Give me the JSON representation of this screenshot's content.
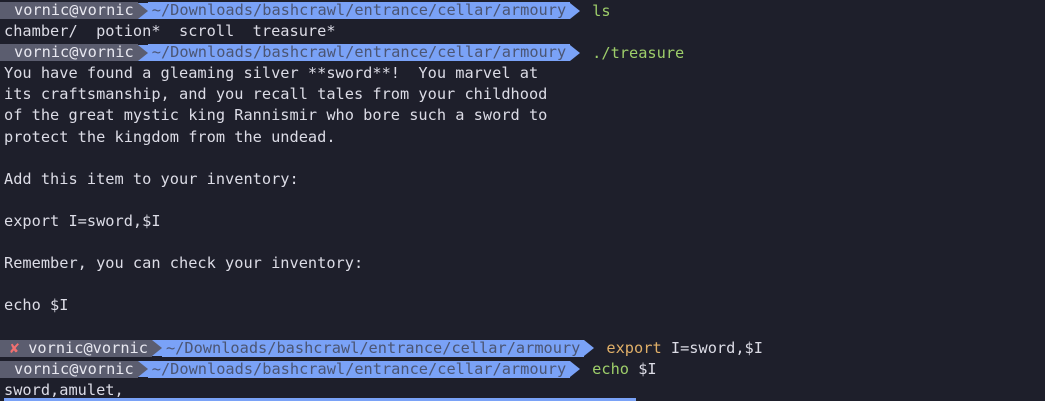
{
  "prompts": [
    {
      "user": "vornic@vornic",
      "path": "~/Downloads/bashcrawl/entrance/cellar/armoury",
      "cmd": "ls",
      "cmd_arg": ""
    },
    {
      "user": "vornic@vornic",
      "path": "~/Downloads/bashcrawl/entrance/cellar/armoury",
      "cmd": "./treasure",
      "cmd_arg": ""
    },
    {
      "error_mark": "✘",
      "user": "vornic@vornic",
      "path": "~/Downloads/bashcrawl/entrance/cellar/armoury",
      "cmd": "export",
      "cmd_arg": " I=sword,$I"
    },
    {
      "user": "vornic@vornic",
      "path": "~/Downloads/bashcrawl/entrance/cellar/armoury",
      "cmd": "echo",
      "cmd_arg": " $I"
    }
  ],
  "output": {
    "ls": "chamber/  potion*  scroll  treasure*",
    "treasure": [
      "You have found a gleaming silver **sword**!  You marvel at",
      "its craftsmanship, and you recall tales from your childhood",
      "of the great mystic king Rannismir who bore such a sword to",
      "protect the kingdom from the undead.",
      "",
      "Add this item to your inventory:",
      "",
      "export I=sword,$I",
      "",
      "Remember, you can check your inventory:",
      "",
      "echo $I",
      ""
    ],
    "echo": "sword,amulet,"
  },
  "colors": {
    "background": "#1e1f2b",
    "user_segment": "#5b5d6f",
    "path_segment": "#7aa2f7",
    "command_green": "#9ece6a",
    "command_yellow": "#e0af68",
    "error": "#f07070"
  }
}
